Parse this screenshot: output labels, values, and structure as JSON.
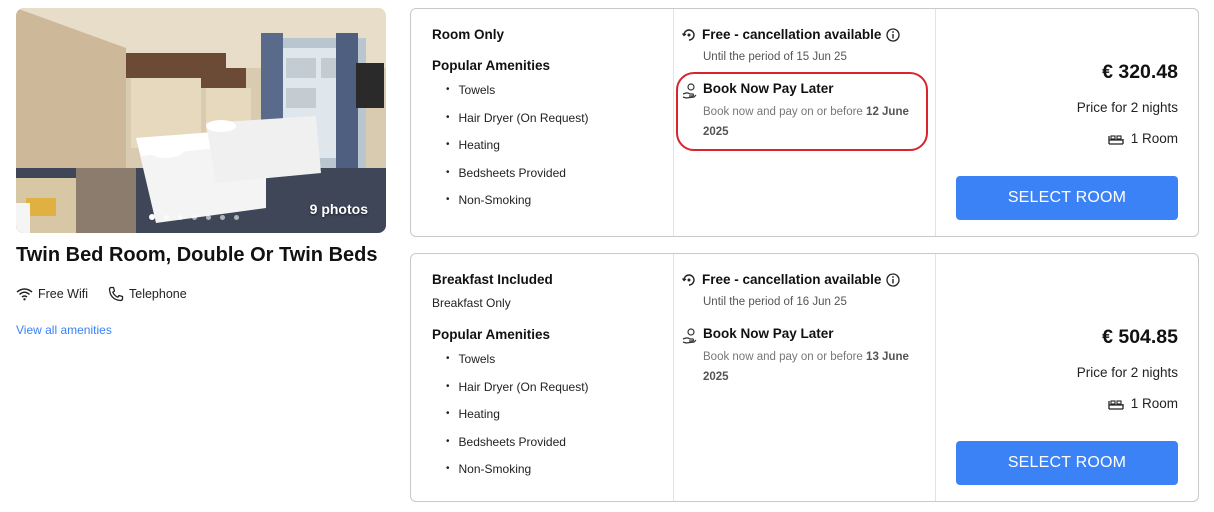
{
  "room": {
    "photo_count": "9 photos",
    "title": "Twin Bed Room, Double Or Twin Beds",
    "amenities": [
      {
        "icon": "wifi-icon",
        "label": "Free Wifi"
      },
      {
        "icon": "telephone-icon",
        "label": "Telephone"
      }
    ],
    "view_all": "View all amenities",
    "carousel": {
      "total": 7,
      "active": 0
    }
  },
  "options": [
    {
      "plan": "Room Only",
      "plan_sub": "",
      "popular_label": "Popular Amenities",
      "amenities": [
        "Towels",
        "Hair Dryer (On Request)",
        "Heating",
        "Bedsheets Provided",
        "Non-Smoking"
      ],
      "cancellation": "Free - cancellation available",
      "until": "Until the period of 15 Jun 25",
      "bnpl_title": "Book Now Pay Later",
      "bnpl_desc": "Book now and pay on or before",
      "bnpl_date": "12 June 2025",
      "price": "€ 320.48",
      "nights": "Price for 2 nights",
      "rooms": "1 Room",
      "button": "SELECT ROOM",
      "highlighted": true
    },
    {
      "plan": "Breakfast Included",
      "plan_sub": "Breakfast Only",
      "popular_label": "Popular Amenities",
      "amenities": [
        "Towels",
        "Hair Dryer (On Request)",
        "Heating",
        "Bedsheets Provided",
        "Non-Smoking"
      ],
      "cancellation": "Free - cancellation available",
      "until": "Until the period of 16 Jun 25",
      "bnpl_title": "Book Now Pay Later",
      "bnpl_desc": "Book now and pay on or before",
      "bnpl_date": "13 June 2025",
      "price": "€ 504.85",
      "nights": "Price for 2 nights",
      "rooms": "1 Room",
      "button": "SELECT ROOM",
      "highlighted": false
    }
  ],
  "colors": {
    "accent": "#3b82f6",
    "highlight": "#d9232d",
    "border": "#c9c9c9"
  }
}
